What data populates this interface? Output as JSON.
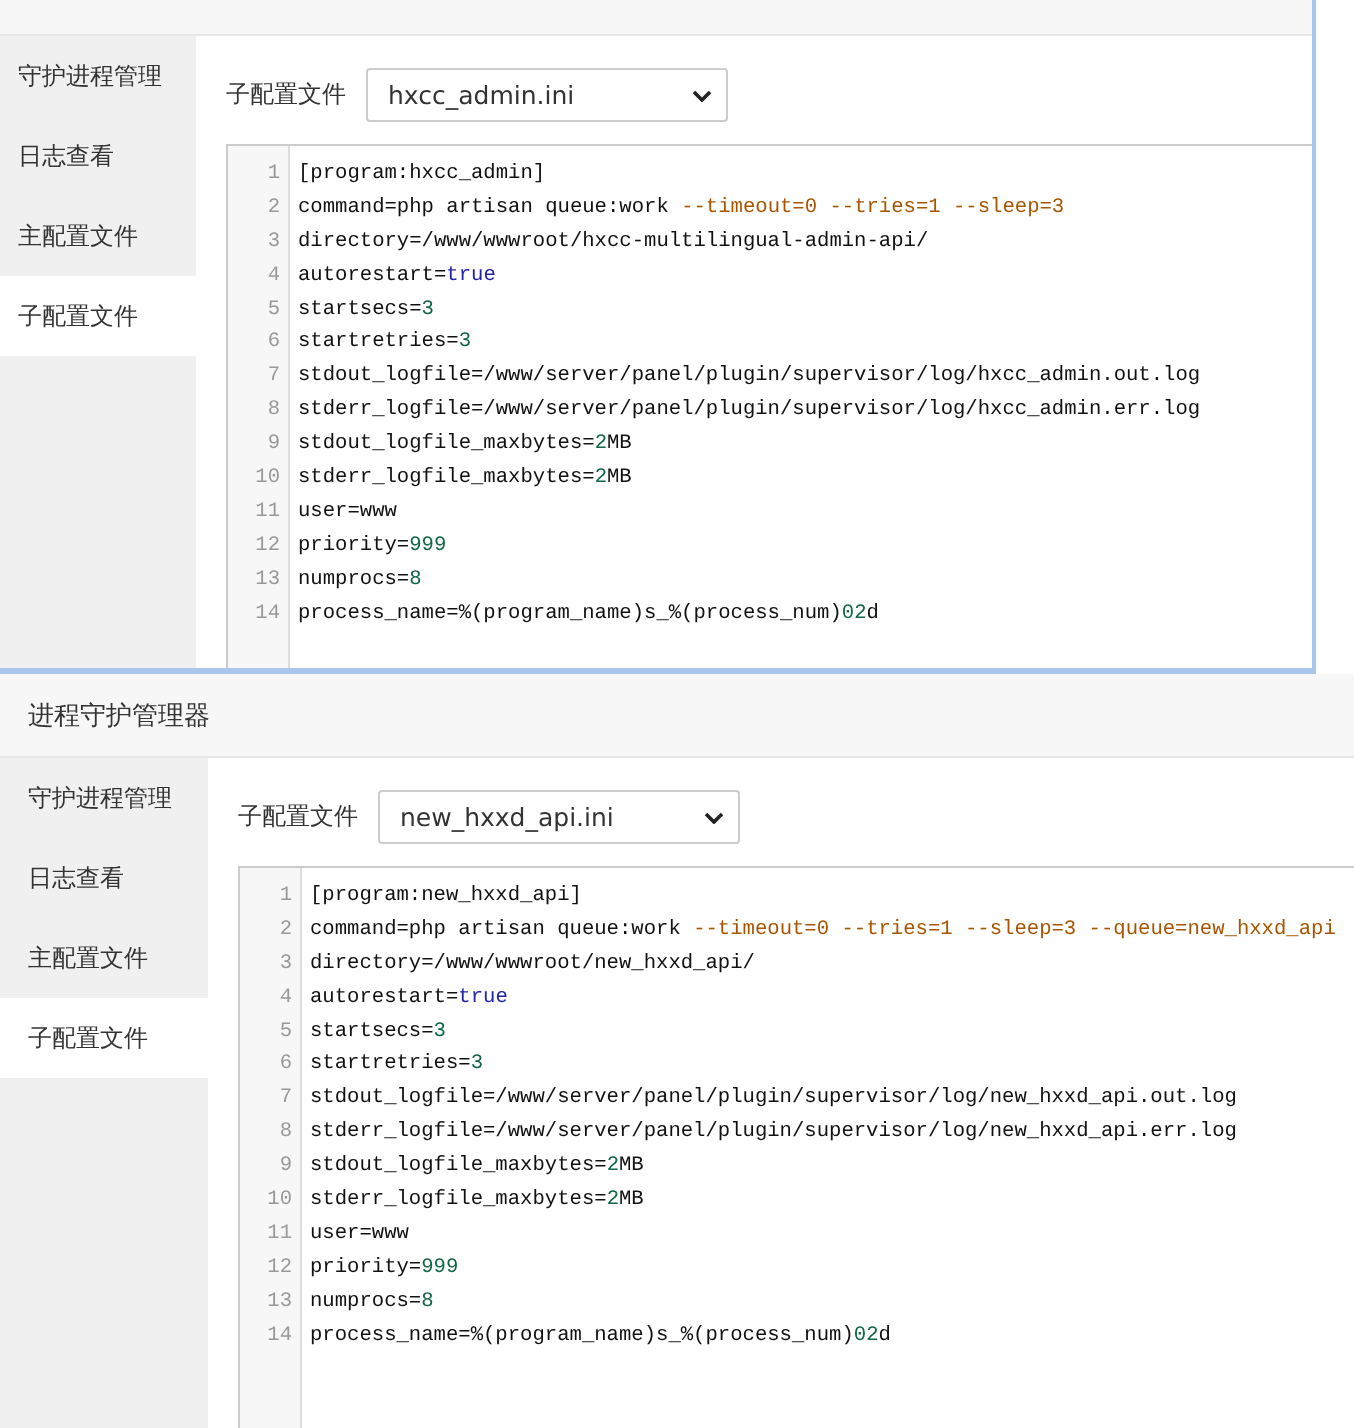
{
  "panels": [
    {
      "sidebar": {
        "items": [
          {
            "label": "守护进程管理",
            "selected": false
          },
          {
            "label": "日志查看",
            "selected": false
          },
          {
            "label": "主配置文件",
            "selected": false
          },
          {
            "label": "子配置文件",
            "selected": true
          }
        ]
      },
      "config_select": {
        "label": "子配置文件",
        "value": "hxcc_admin.ini"
      },
      "editor": {
        "lines": [
          {
            "number": "1",
            "segments": [
              {
                "kind": "plain",
                "text": "[program:hxcc_admin]"
              }
            ]
          },
          {
            "number": "2",
            "segments": [
              {
                "kind": "plain",
                "text": "command=php artisan queue:work "
              },
              {
                "kind": "option",
                "text": "--timeout=0 --tries=1 --sleep=3"
              }
            ]
          },
          {
            "number": "3",
            "segments": [
              {
                "kind": "plain",
                "text": "directory=/www/wwwroot/hxcc-multilingual-admin-api/"
              }
            ]
          },
          {
            "number": "4",
            "segments": [
              {
                "kind": "plain",
                "text": "autorestart="
              },
              {
                "kind": "keyword",
                "text": "true"
              }
            ]
          },
          {
            "number": "5",
            "segments": [
              {
                "kind": "plain",
                "text": "startsecs="
              },
              {
                "kind": "number",
                "text": "3"
              }
            ]
          },
          {
            "number": "6",
            "segments": [
              {
                "kind": "plain",
                "text": "startretries="
              },
              {
                "kind": "number",
                "text": "3"
              }
            ]
          },
          {
            "number": "7",
            "segments": [
              {
                "kind": "plain",
                "text": "stdout_logfile=/www/server/panel/plugin/supervisor/log/hxcc_admin.out.log"
              }
            ]
          },
          {
            "number": "8",
            "segments": [
              {
                "kind": "plain",
                "text": "stderr_logfile=/www/server/panel/plugin/supervisor/log/hxcc_admin.err.log"
              }
            ]
          },
          {
            "number": "9",
            "segments": [
              {
                "kind": "plain",
                "text": "stdout_logfile_maxbytes="
              },
              {
                "kind": "number",
                "text": "2"
              },
              {
                "kind": "plain",
                "text": "MB"
              }
            ]
          },
          {
            "number": "10",
            "segments": [
              {
                "kind": "plain",
                "text": "stderr_logfile_maxbytes="
              },
              {
                "kind": "number",
                "text": "2"
              },
              {
                "kind": "plain",
                "text": "MB"
              }
            ]
          },
          {
            "number": "11",
            "segments": [
              {
                "kind": "plain",
                "text": "user=www"
              }
            ]
          },
          {
            "number": "12",
            "segments": [
              {
                "kind": "plain",
                "text": "priority="
              },
              {
                "kind": "number",
                "text": "999"
              }
            ]
          },
          {
            "number": "13",
            "segments": [
              {
                "kind": "plain",
                "text": "numprocs="
              },
              {
                "kind": "number",
                "text": "8"
              }
            ]
          },
          {
            "number": "14",
            "segments": [
              {
                "kind": "plain",
                "text": "process_name=%(program_name)s_%(process_num)"
              },
              {
                "kind": "number",
                "text": "02"
              },
              {
                "kind": "plain",
                "text": "d"
              }
            ]
          }
        ]
      }
    },
    {
      "title": "进程守护管理器",
      "sidebar": {
        "items": [
          {
            "label": "守护进程管理",
            "selected": false
          },
          {
            "label": "日志查看",
            "selected": false
          },
          {
            "label": "主配置文件",
            "selected": false
          },
          {
            "label": "子配置文件",
            "selected": true
          }
        ]
      },
      "config_select": {
        "label": "子配置文件",
        "value": "new_hxxd_api.ini"
      },
      "editor": {
        "lines": [
          {
            "number": "1",
            "segments": [
              {
                "kind": "plain",
                "text": "[program:new_hxxd_api]"
              }
            ]
          },
          {
            "number": "2",
            "segments": [
              {
                "kind": "plain",
                "text": "command=php artisan queue:work "
              },
              {
                "kind": "option",
                "text": "--timeout=0 --tries=1 --sleep=3 --queue=new_hxxd_api"
              }
            ]
          },
          {
            "number": "3",
            "segments": [
              {
                "kind": "plain",
                "text": "directory=/www/wwwroot/new_hxxd_api/"
              }
            ]
          },
          {
            "number": "4",
            "segments": [
              {
                "kind": "plain",
                "text": "autorestart="
              },
              {
                "kind": "keyword",
                "text": "true"
              }
            ]
          },
          {
            "number": "5",
            "segments": [
              {
                "kind": "plain",
                "text": "startsecs="
              },
              {
                "kind": "number",
                "text": "3"
              }
            ]
          },
          {
            "number": "6",
            "segments": [
              {
                "kind": "plain",
                "text": "startretries="
              },
              {
                "kind": "number",
                "text": "3"
              }
            ]
          },
          {
            "number": "7",
            "segments": [
              {
                "kind": "plain",
                "text": "stdout_logfile=/www/server/panel/plugin/supervisor/log/new_hxxd_api.out.log"
              }
            ]
          },
          {
            "number": "8",
            "segments": [
              {
                "kind": "plain",
                "text": "stderr_logfile=/www/server/panel/plugin/supervisor/log/new_hxxd_api.err.log"
              }
            ]
          },
          {
            "number": "9",
            "segments": [
              {
                "kind": "plain",
                "text": "stdout_logfile_maxbytes="
              },
              {
                "kind": "number",
                "text": "2"
              },
              {
                "kind": "plain",
                "text": "MB"
              }
            ]
          },
          {
            "number": "10",
            "segments": [
              {
                "kind": "plain",
                "text": "stderr_logfile_maxbytes="
              },
              {
                "kind": "number",
                "text": "2"
              },
              {
                "kind": "plain",
                "text": "MB"
              }
            ]
          },
          {
            "number": "11",
            "segments": [
              {
                "kind": "plain",
                "text": "user=www"
              }
            ]
          },
          {
            "number": "12",
            "segments": [
              {
                "kind": "plain",
                "text": "priority="
              },
              {
                "kind": "number",
                "text": "999"
              }
            ]
          },
          {
            "number": "13",
            "segments": [
              {
                "kind": "plain",
                "text": "numprocs="
              },
              {
                "kind": "number",
                "text": "8"
              }
            ]
          },
          {
            "number": "14",
            "segments": [
              {
                "kind": "plain",
                "text": "process_name=%(program_name)s_%(process_num)"
              },
              {
                "kind": "number",
                "text": "02"
              },
              {
                "kind": "plain",
                "text": "d"
              }
            ]
          }
        ]
      }
    }
  ]
}
